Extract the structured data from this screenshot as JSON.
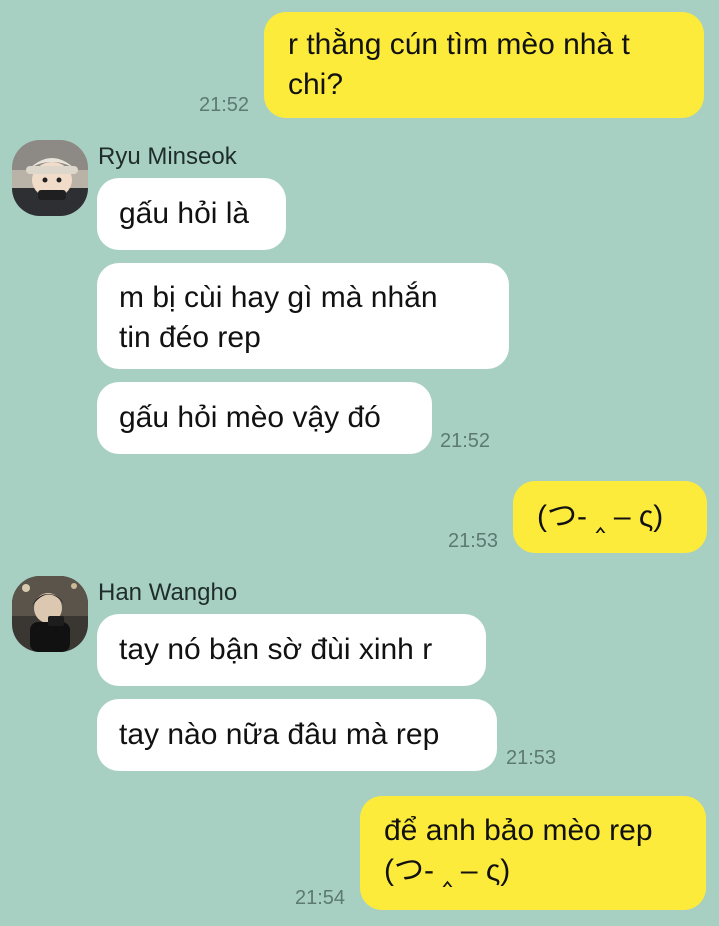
{
  "messages": [
    {
      "text": "r thằng cún tìm mèo nhà t\nchi?",
      "time": "21:52"
    },
    {
      "text": "gấu hỏi là"
    },
    {
      "text": "m bị cùi hay gì mà nhắn\ntin đéo rep"
    },
    {
      "text": "gấu hỏi mèo vậy đó",
      "time": "21:52"
    },
    {
      "text": "(つ- ‸ – ς)",
      "time": "21:53"
    },
    {
      "text": "tay nó bận sờ đùi xinh r"
    },
    {
      "text": "tay nào nữa đâu mà rep",
      "time": "21:53"
    },
    {
      "text": "để anh bảo mèo rep\n(つ- ‸ – ς)",
      "time": "21:54"
    }
  ],
  "senders": [
    {
      "name": "Ryu Minseok",
      "avatar": "avatar-ryu-minseok"
    },
    {
      "name": "Han Wangho",
      "avatar": "avatar-han-wangho"
    }
  ],
  "colors": {
    "background": "#a7cfc2",
    "my_bubble": "#fdeb3c",
    "other_bubble": "#ffffff",
    "timestamp": "#5d7a72"
  }
}
